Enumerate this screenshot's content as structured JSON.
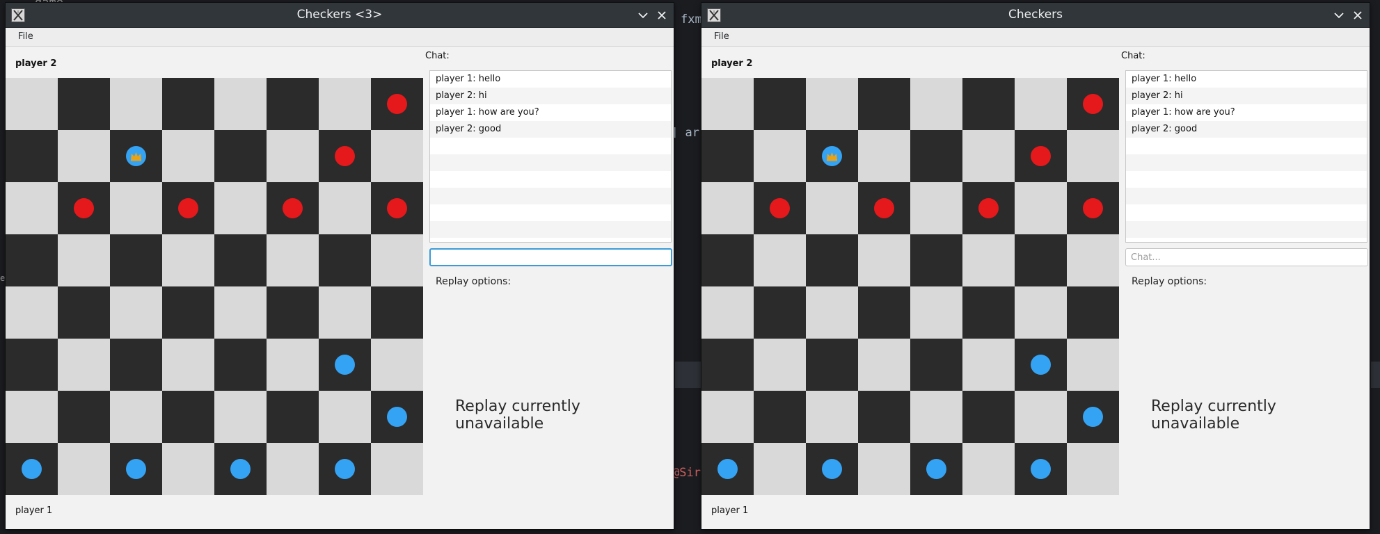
{
  "background": {
    "fragments": [
      "game",
      "fxm",
      "] ar",
      "@Sir",
      "es"
    ]
  },
  "windows": [
    {
      "title": "Checkers <3>",
      "menu": {
        "file": "File"
      },
      "player_top": "player 2",
      "player_bottom": "player 1",
      "chat_label": "Chat:",
      "chat_messages": [
        "player 1: hello",
        "player 2: hi",
        "player 1: how are you?",
        "player 2: good"
      ],
      "chat_input_value": "",
      "chat_placeholder": "",
      "replay_label": "Replay options:",
      "replay_status": "Replay currently unavailable"
    },
    {
      "title": "Checkers",
      "menu": {
        "file": "File"
      },
      "player_top": "player 2",
      "player_bottom": "player 1",
      "chat_label": "Chat:",
      "chat_messages": [
        "player 1: hello",
        "player 2: hi",
        "player 1: how are you?",
        "player 2: good"
      ],
      "chat_input_value": "",
      "chat_placeholder": "Chat...",
      "replay_label": "Replay options:",
      "replay_status": "Replay currently unavailable"
    }
  ],
  "board": {
    "size": 8,
    "pieces": [
      {
        "row": 0,
        "col": 7,
        "color": "red"
      },
      {
        "row": 1,
        "col": 2,
        "color": "blue",
        "king": true
      },
      {
        "row": 1,
        "col": 6,
        "color": "red"
      },
      {
        "row": 2,
        "col": 1,
        "color": "red"
      },
      {
        "row": 2,
        "col": 3,
        "color": "red"
      },
      {
        "row": 2,
        "col": 5,
        "color": "red"
      },
      {
        "row": 2,
        "col": 7,
        "color": "red"
      },
      {
        "row": 5,
        "col": 6,
        "color": "blue"
      },
      {
        "row": 6,
        "col": 7,
        "color": "blue"
      },
      {
        "row": 7,
        "col": 0,
        "color": "blue"
      },
      {
        "row": 7,
        "col": 2,
        "color": "blue"
      },
      {
        "row": 7,
        "col": 4,
        "color": "blue"
      },
      {
        "row": 7,
        "col": 6,
        "color": "blue"
      }
    ]
  },
  "colors": {
    "red_piece": "#e5191b",
    "blue_piece": "#35a3f4",
    "dark_square": "#2b2b2b",
    "light_square": "#d9d9d9",
    "crown": "#e8a317",
    "titlebar": "#31363b"
  },
  "icons": [
    "app-icon",
    "minimize-icon",
    "close-icon",
    "crown-icon"
  ]
}
